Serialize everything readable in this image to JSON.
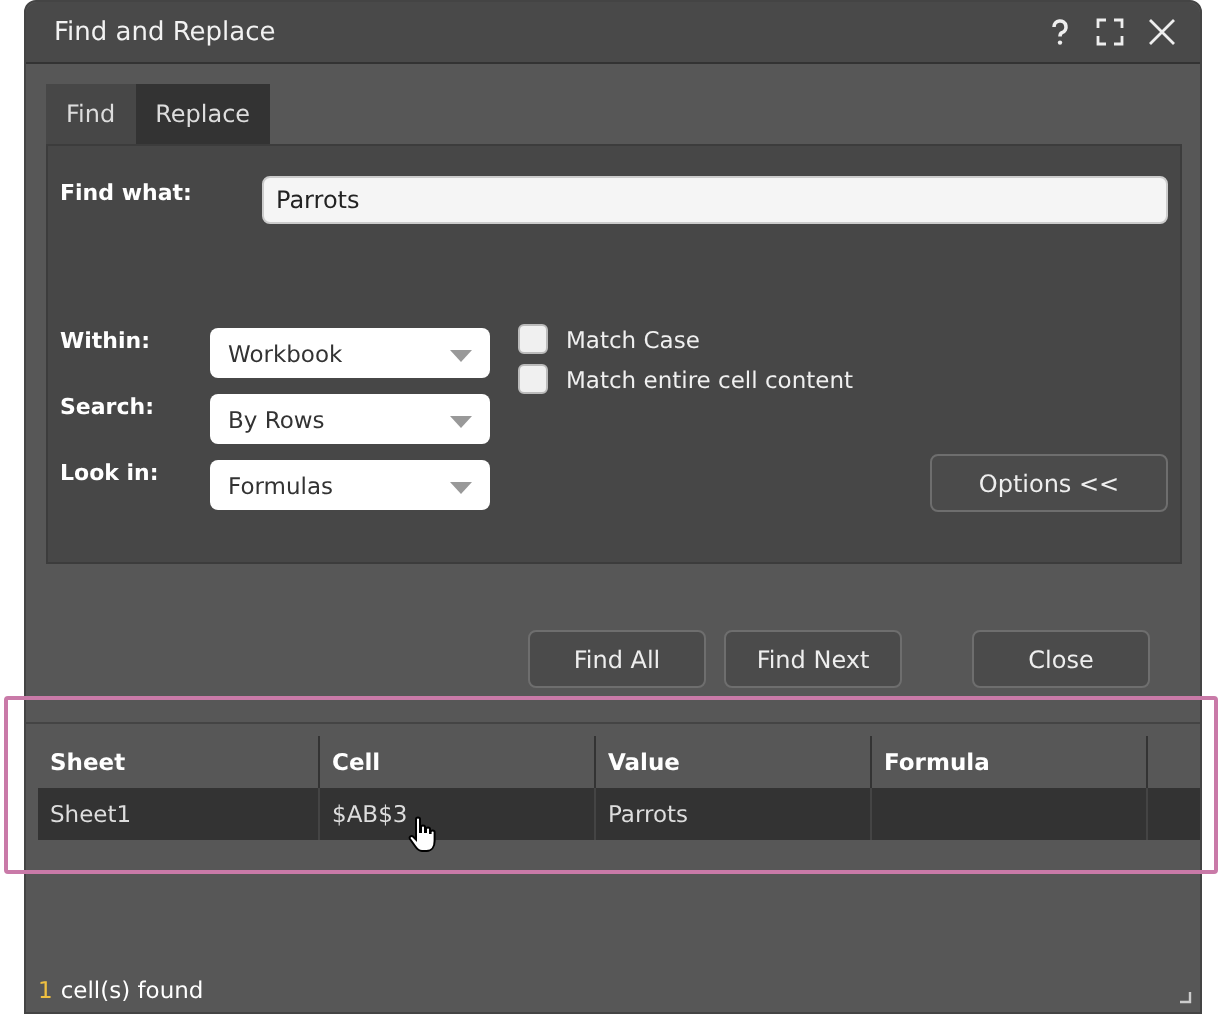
{
  "window": {
    "title": "Find and Replace"
  },
  "tabs": [
    {
      "label": "Find",
      "selected": true
    },
    {
      "label": "Replace",
      "selected": false
    }
  ],
  "find_what": {
    "label": "Find what:",
    "value": "Parrots"
  },
  "options": [
    {
      "label": "Within:",
      "value": "Workbook"
    },
    {
      "label": "Search:",
      "value": "By Rows"
    },
    {
      "label": "Look in:",
      "value": "Formulas"
    }
  ],
  "checkboxes": [
    {
      "label": "Match Case",
      "checked": false
    },
    {
      "label": "Match entire cell content",
      "checked": false
    }
  ],
  "options_button": "Options <<",
  "buttons": [
    "Find All",
    "Find Next",
    "Close"
  ],
  "table": {
    "columns": [
      "Sheet",
      "Cell",
      "Value",
      "Formula"
    ],
    "rows": [
      {
        "cells": [
          "Sheet1",
          "$AB$3",
          "Parrots",
          ""
        ],
        "selected": true
      }
    ]
  },
  "status_bar": {
    "count": "1",
    "text": "cell(s) found"
  }
}
